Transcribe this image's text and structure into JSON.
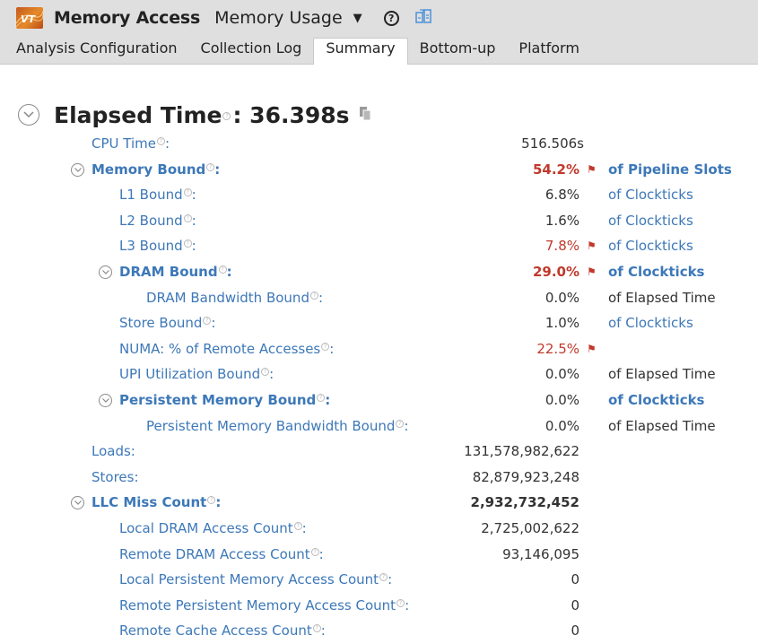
{
  "header": {
    "logo_text": "VT",
    "app_title": "Memory Access",
    "view_select": "Memory Usage",
    "help_icon": "question-circle-icon",
    "compare_icon": "compare-results-icon"
  },
  "tabs": [
    {
      "label": "Analysis Configuration",
      "active": false
    },
    {
      "label": "Collection Log",
      "active": false
    },
    {
      "label": "Summary",
      "active": true
    },
    {
      "label": "Bottom-up",
      "active": false
    },
    {
      "label": "Platform",
      "active": false
    }
  ],
  "summary": {
    "elapsed_label": "Elapsed Time",
    "elapsed_value": ": 36.398s",
    "rows": [
      {
        "label": "CPU Time",
        "suffix": ":",
        "value": "516.506s",
        "unit": ""
      },
      {
        "label": "Memory Bound",
        "suffix": ":",
        "value": "54.2%",
        "unit": "of Pipeline Slots"
      },
      {
        "label": "L1 Bound",
        "suffix": ":",
        "value": "6.8%",
        "unit": "of Clockticks"
      },
      {
        "label": "L2 Bound",
        "suffix": ":",
        "value": "1.6%",
        "unit": "of Clockticks"
      },
      {
        "label": "L3 Bound",
        "suffix": ":",
        "value": "7.8%",
        "unit": "of Clockticks"
      },
      {
        "label": "DRAM Bound",
        "suffix": ":",
        "value": "29.0%",
        "unit": "of Clockticks"
      },
      {
        "label": "DRAM Bandwidth Bound",
        "suffix": ":",
        "value": "0.0%",
        "unit": "of Elapsed Time"
      },
      {
        "label": "Store Bound",
        "suffix": ":",
        "value": "1.0%",
        "unit": "of Clockticks"
      },
      {
        "label": "NUMA: % of Remote Accesses",
        "suffix": ":",
        "value": "22.5%",
        "unit": ""
      },
      {
        "label": "UPI Utilization Bound",
        "suffix": ":",
        "value": "0.0%",
        "unit": "of Elapsed Time"
      },
      {
        "label": "Persistent Memory Bound",
        "suffix": ":",
        "value": "0.0%",
        "unit": "of Clockticks"
      },
      {
        "label": "Persistent Memory Bandwidth Bound",
        "suffix": ":",
        "value": "0.0%",
        "unit": "of Elapsed Time"
      },
      {
        "label": "Loads:",
        "suffix": "",
        "value": "131,578,982,622",
        "unit": ""
      },
      {
        "label": "Stores:",
        "suffix": "",
        "value": "82,879,923,248",
        "unit": ""
      },
      {
        "label": "LLC Miss Count",
        "suffix": ":",
        "value": "2,932,732,452",
        "unit": ""
      },
      {
        "label": "Local DRAM Access Count",
        "suffix": ":",
        "value": "2,725,002,622",
        "unit": ""
      },
      {
        "label": "Remote DRAM Access Count",
        "suffix": ":",
        "value": "93,146,095",
        "unit": ""
      },
      {
        "label": "Local Persistent Memory Access Count",
        "suffix": ":",
        "value": "0",
        "unit": ""
      },
      {
        "label": "Remote Persistent Memory Access Count",
        "suffix": ":",
        "value": "0",
        "unit": ""
      },
      {
        "label": "Remote Cache Access Count",
        "suffix": ":",
        "value": "0",
        "unit": ""
      }
    ]
  },
  "colors": {
    "link_blue": "#3d78b8",
    "alert_red": "#c0392b",
    "header_gray": "#dfdfdf"
  }
}
